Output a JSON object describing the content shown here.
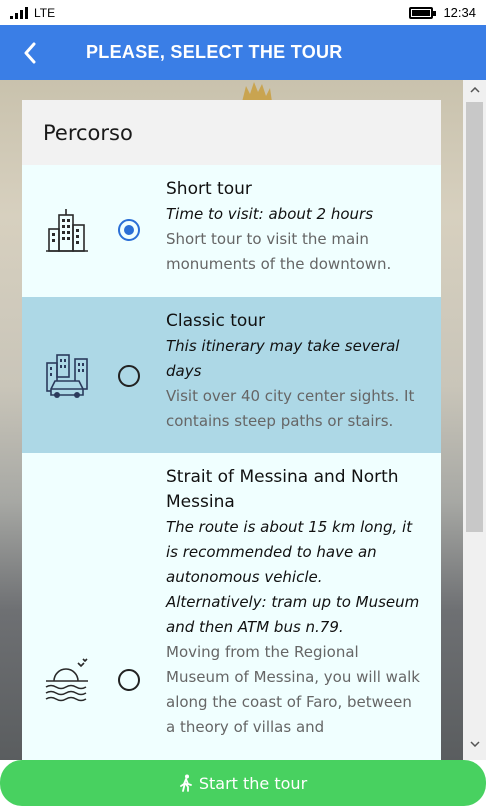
{
  "status_bar": {
    "network": "LTE",
    "time": "12:34",
    "signal_icon": "signal-icon",
    "battery_icon": "battery-icon"
  },
  "app_bar": {
    "title": "PLEASE, SELECT THE TOUR",
    "back_icon": "back-arrow-icon"
  },
  "card": {
    "header": "Percorso",
    "options": [
      {
        "title": "Short tour",
        "subtitle": "Time to visit: about 2 hours",
        "description": "Short tour to visit the main monuments of the downtown.",
        "icon": "city-buildings-icon",
        "selected": true
      },
      {
        "title": "Classic tour",
        "subtitle": "This itinerary may take several days",
        "description": "Visit over 40 city center sights. It contains steep paths or stairs.",
        "icon": "city-car-icon",
        "selected": false
      },
      {
        "title": "Strait of Messina and North Messina",
        "subtitle": "The route is about 15 km long, it is recommended to have an autonomous vehicle. Alternatively: tram up to Museum and then ATM bus n.79.",
        "description": "Moving from the Regional Museum of Messina, you will walk along the coast of Faro, between a theory of villas and",
        "icon": "sea-sun-birds-icon",
        "selected": false
      }
    ]
  },
  "start_button": {
    "label": "Start the tour",
    "icon": "walking-person-icon"
  },
  "colors": {
    "app_bar": "#3a7ee6",
    "selected_row": "#add8e6",
    "row": "#f0ffff",
    "start_button": "#48d160",
    "radio_checked": "#2b6fd6"
  }
}
